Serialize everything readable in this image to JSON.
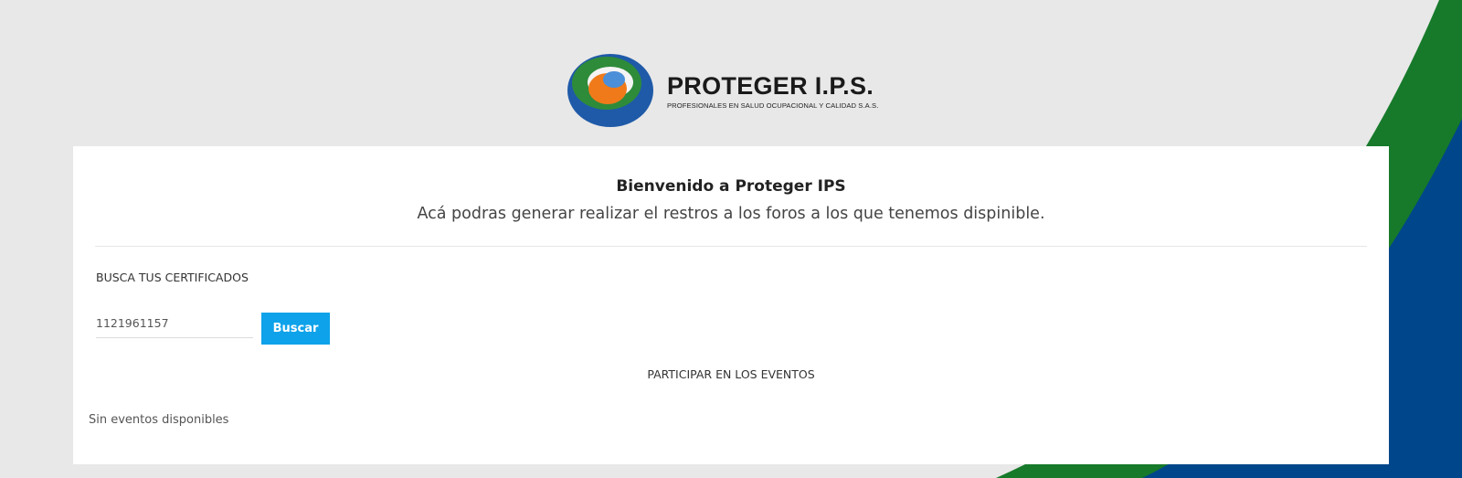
{
  "brand": {
    "name": "PROTEGER I.P.S.",
    "tagline": "PROFESIONALES EN SALUD OCUPACIONAL Y CALIDAD S.A.S.",
    "colors": {
      "green": "#1a7a2a",
      "blue": "#1f5aa8",
      "orange": "#f07a1a"
    }
  },
  "welcome": {
    "title": "Bienvenido a Proteger IPS",
    "subtitle": "Acá podras generar realizar el restros a los foros a los que tenemos dispinible."
  },
  "certificates": {
    "label": "BUSCA TUS CERTIFICADOS",
    "input_value": "1121961157",
    "button_label": "Buscar",
    "button_color": "#0ea2ea"
  },
  "events": {
    "label": "PARTICIPAR EN LOS EVENTOS",
    "empty_message": "Sin eventos disponibles"
  }
}
